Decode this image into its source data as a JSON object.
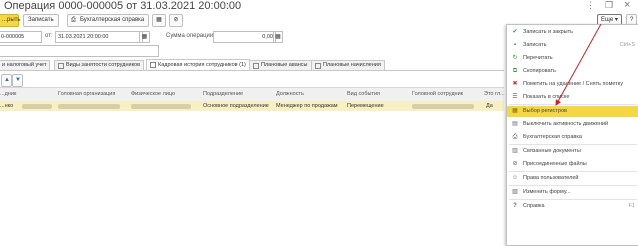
{
  "window": {
    "title": "Операция 0000-000005 от 31.03.2021 20:00:00",
    "star": "☆",
    "more_icon": "⋮",
    "restore_icon": "❐",
    "close_icon": "×"
  },
  "toolbar": {
    "post_close": "...рыть",
    "save": "Записать",
    "accounting_ref": "Бухгалтерская справка",
    "more": "Еще",
    "help": "?"
  },
  "fields": {
    "number_value": "0-000005",
    "date_label": "от:",
    "date_value": "31.03.2021 20:00:00",
    "sum_label": "Сумма операции:",
    "sum_value": "0,00"
  },
  "tabs": [
    {
      "label": "и налоговый учет"
    },
    {
      "label": "Виды занятости сотрудников"
    },
    {
      "label": "Кадровая история сотрудников (1)"
    },
    {
      "label": "Плановые авансы"
    },
    {
      "label": "Плановые начисления"
    }
  ],
  "grid": {
    "columns": [
      "...дник",
      "Головная организация",
      "Физическое лицо",
      "Подразделение",
      "Должность",
      "Вид события",
      "Головной сотрудник",
      "Это гл..."
    ],
    "row": {
      "c0": "...нко",
      "c3": "Основное подразделение",
      "c4": "Менеджер по продажам",
      "c5": "Перемещение",
      "c7": "Да"
    }
  },
  "menu": {
    "items": [
      {
        "label": "Записать и закрыть",
        "shortcut": "",
        "icon": "✔"
      },
      {
        "label": "Записать",
        "shortcut": "Ctrl+S",
        "icon": "▪"
      },
      {
        "label": "Перечитать",
        "shortcut": "",
        "icon": "↻"
      },
      {
        "label": "Скопировать",
        "shortcut": "",
        "icon": "⧉"
      },
      {
        "label": "Пометить на удаление / Снять пометку",
        "shortcut": "",
        "icon": "✖"
      },
      {
        "label": "Показать в списке",
        "shortcut": "",
        "icon": "☰"
      },
      {
        "label": "Выбор регистров",
        "shortcut": "",
        "icon": "▦"
      },
      {
        "label": "Выключить активность движений",
        "shortcut": "",
        "icon": "▤"
      },
      {
        "label": "Бухгалтерская справка",
        "shortcut": "",
        "icon": "⎙"
      },
      {
        "label": "Связанные документы",
        "shortcut": "",
        "icon": "▥"
      },
      {
        "label": "Присоединенные файлы",
        "shortcut": "",
        "icon": "⊘"
      },
      {
        "label": "Права пользователей",
        "shortcut": "",
        "icon": "☺"
      },
      {
        "label": "Изменить форму...",
        "shortcut": "",
        "icon": "▧"
      },
      {
        "label": "Справка",
        "shortcut": "F1",
        "icon": "?"
      }
    ]
  },
  "colors": {
    "accent": "#f5d743",
    "arrow": "#d22020",
    "row_highlight": "#f8f0c3"
  }
}
